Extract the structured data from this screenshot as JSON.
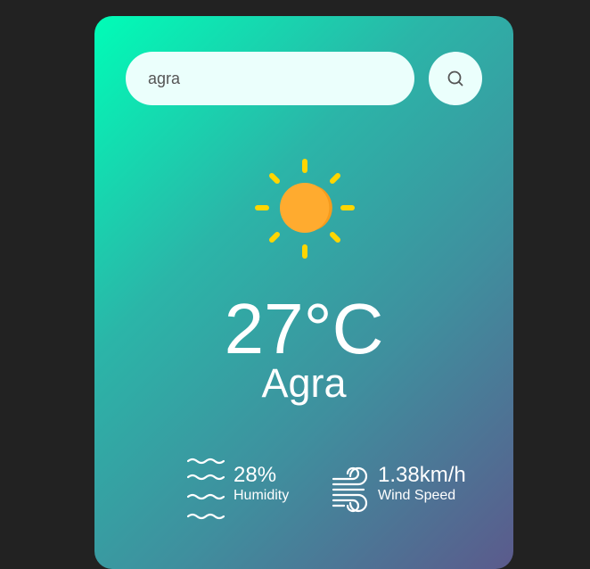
{
  "search": {
    "value": "agra",
    "button_icon": "search-icon"
  },
  "weather": {
    "icon": "sun-icon",
    "temperature": "27°C",
    "city": "Agra"
  },
  "details": {
    "humidity": {
      "icon": "humidity-icon",
      "value": "28%",
      "label": "Humidity"
    },
    "wind": {
      "icon": "wind-icon",
      "value": "1.38km/h",
      "label": "Wind Speed"
    }
  },
  "colors": {
    "page_background": "#222222",
    "card_gradient": [
      "#00fdb7",
      "#5b5a8c"
    ],
    "input_background": "#ebfffc",
    "sun_body": "#ffab2f",
    "sun_rays": "#ffd600",
    "text": "#ffffff"
  }
}
